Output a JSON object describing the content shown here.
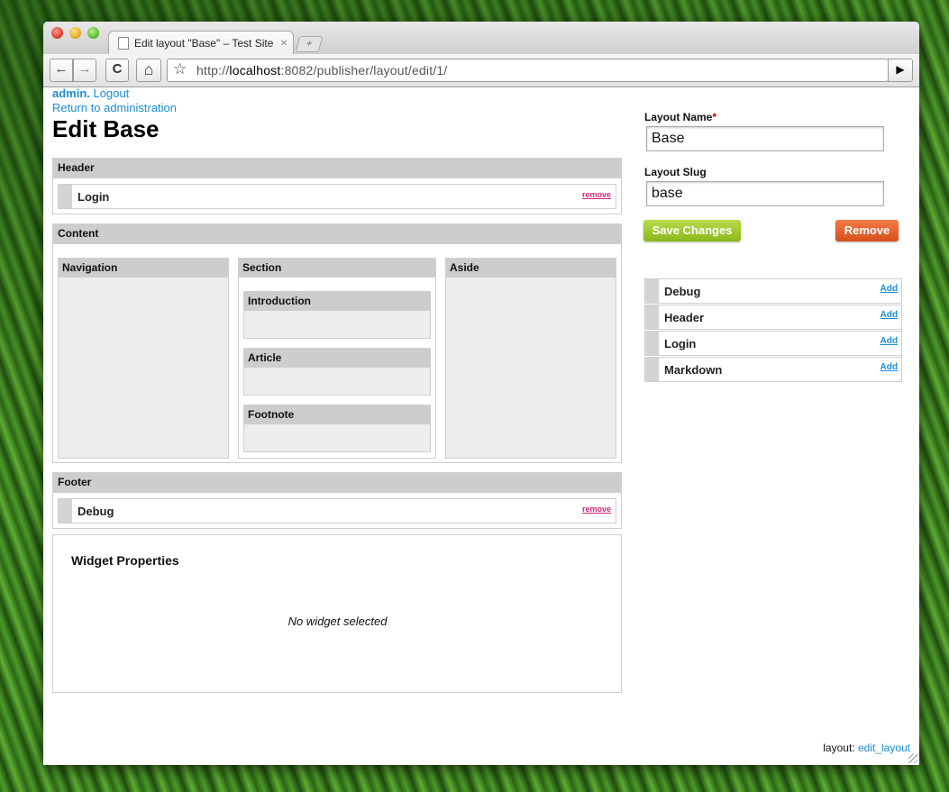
{
  "browser": {
    "tab_title": "Edit layout \"Base\" – Test Site",
    "tab_close": "×",
    "new_tab": "+",
    "url_scheme": "http://",
    "url_host": "localhost",
    "url_rest": ":8082/publisher/layout/edit/1/",
    "back": "←",
    "forward": "→",
    "reload": "C",
    "home": "⌂",
    "bookmark": "☆",
    "go": "▶"
  },
  "user": {
    "name": "admin.",
    "logout": "Logout",
    "return_link": "Return to administration"
  },
  "page_title": "Edit Base",
  "regions": {
    "header": {
      "title": "Header",
      "widgets": [
        {
          "label": "Login",
          "remove": "remove"
        }
      ]
    },
    "content": {
      "title": "Content",
      "navigation": "Navigation",
      "section": "Section",
      "aside": "Aside",
      "subsections": [
        "Introduction",
        "Article",
        "Footnote"
      ]
    },
    "footer": {
      "title": "Footer",
      "widgets": [
        {
          "label": "Debug",
          "remove": "remove"
        }
      ]
    }
  },
  "widget_properties": {
    "title": "Widget Properties",
    "empty": "No widget selected"
  },
  "form": {
    "name_label": "Layout Name",
    "required_mark": "*",
    "name_value": "Base",
    "slug_label": "Layout Slug",
    "slug_value": "base",
    "save": "Save Changes",
    "remove": "Remove"
  },
  "available_widgets": [
    {
      "label": "Debug",
      "add": "Add"
    },
    {
      "label": "Header",
      "add": "Add"
    },
    {
      "label": "Login",
      "add": "Add"
    },
    {
      "label": "Markdown",
      "add": "Add"
    }
  ],
  "footer": {
    "prefix": "layout:",
    "link": "edit_layout"
  },
  "colors": {
    "link": "#1a8cd8",
    "save_button": "#9cc92c",
    "remove_button": "#e8622c",
    "remove_link": "#d0267a",
    "region_header": "#cdcdcd"
  }
}
